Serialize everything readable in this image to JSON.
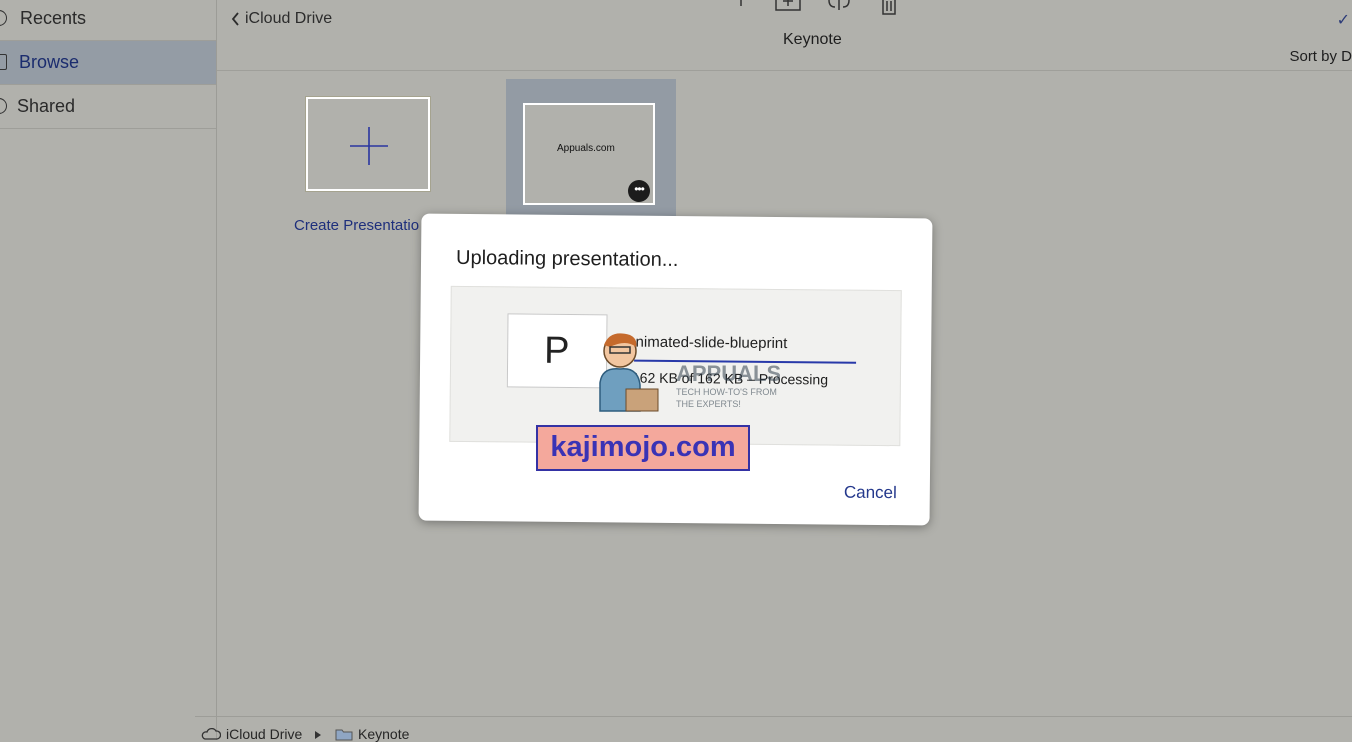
{
  "sidebar": {
    "items": [
      {
        "label": "Recents",
        "icon": "clock-icon",
        "active": false
      },
      {
        "label": "Browse",
        "icon": "folder-icon",
        "active": true
      },
      {
        "label": "Shared",
        "icon": "shared-icon",
        "active": false
      }
    ]
  },
  "header": {
    "back_label": "iCloud Drive",
    "title": "Keynote",
    "sort_label": "Sort by D"
  },
  "content": {
    "create_label": "Create Presentatio",
    "document_thumbnail_text": "Appuals.com",
    "more_button_glyph": "•••"
  },
  "dialog": {
    "title": "Uploading presentation...",
    "file_icon_letter": "P",
    "file_name": "animated-slide-blueprint",
    "progress": 1.0,
    "status": "162 KB of 162 KB – Processing",
    "cancel_label": "Cancel"
  },
  "path_bar": {
    "segments": [
      "iCloud Drive",
      "Keynote"
    ]
  },
  "watermarks": {
    "badge_text": "kajimojo.com",
    "logo_text": "APPUALS",
    "logo_tagline": "TECH HOW-TO'S FROM THE EXPERTS!"
  },
  "colors": {
    "background": "#b1b1ac",
    "selection": "#949ca5",
    "accent": "#24388c",
    "progress": "#2839a9"
  }
}
